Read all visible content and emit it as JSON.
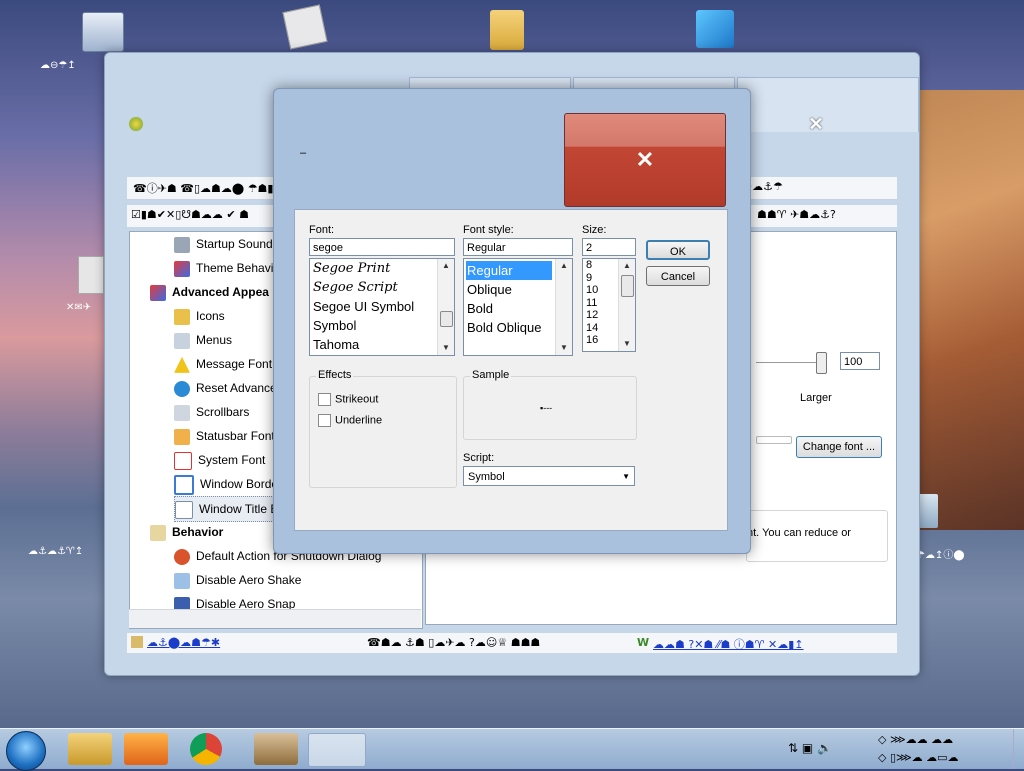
{
  "desktop": {
    "icon_labels": [
      "☁⊖☂↥",
      "✕✉✈",
      "☁⚓☁⚓♈↥",
      "☂☁↥ⓘ⬤"
    ]
  },
  "main_window": {
    "toolbar_glyphs": "☎ⓘ✈☗  ☎▯☁☗☁⬤ ☂☗▮",
    "toolbar2_glyphs": "☑▮☗✔✕▯☋☗☁☁ ✔ ☗",
    "toolbar_right_glyphs": "☗✈☁⚓☂",
    "toolbar2_right_glyphs": "☗☗♈ ✈☗☁⚓?",
    "tree_items": [
      {
        "label": "Startup Sound",
        "group": false
      },
      {
        "label": "Theme Behavio",
        "group": false
      },
      {
        "label": "Advanced Appea",
        "group": true
      },
      {
        "label": "Icons",
        "group": false
      },
      {
        "label": "Menus",
        "group": false
      },
      {
        "label": "Message Font",
        "group": false
      },
      {
        "label": "Reset Advance",
        "group": false
      },
      {
        "label": "Scrollbars",
        "group": false
      },
      {
        "label": "Statusbar Font",
        "group": false
      },
      {
        "label": "System Font",
        "group": false
      },
      {
        "label": "Window Borders",
        "group": false
      },
      {
        "label": "Window Title Ba",
        "group": false
      },
      {
        "label": "Behavior",
        "group": true
      },
      {
        "label": "Default Action for Shutdown Dialog",
        "group": false
      },
      {
        "label": "Disable Aero Shake",
        "group": false
      },
      {
        "label": "Disable Aero Snap",
        "group": false
      }
    ],
    "size_value": "100",
    "larger_label": "Larger",
    "change_font_label": "Change font ...",
    "description_text": "nt. You can reduce or",
    "status_glyphs_left": "☁⚓⬤☁☗☂✱",
    "status_glyphs_mid": "☎☗☁ ⚓☗ ▯☁✈☁ ?☁☺♕ ☗☗☗ ",
    "status_glyphs_right": "☁☁☗ ?✕☗ ⁄⁄☗ ⓘ☗♈ ✕☁▮↥",
    "status_w": "W"
  },
  "font_dialog": {
    "title": "–",
    "font_label": "Font:",
    "font_value": "segoe",
    "font_list": [
      "Segoe Print",
      "Segoe Script",
      "Segoe UI Symbol",
      "Symbol",
      "Tahoma"
    ],
    "style_label": "Font style:",
    "style_value": "Regular",
    "style_list": [
      "Regular",
      "Oblique",
      "Bold",
      "Bold Oblique"
    ],
    "size_label": "Size:",
    "size_value": "2",
    "size_list": [
      "8",
      "9",
      "10",
      "11",
      "12",
      "14",
      "16"
    ],
    "ok_label": "OK",
    "cancel_label": "Cancel",
    "effects_label": "Effects",
    "strikeout_label": "Strikeout",
    "underline_label": "Underline",
    "sample_label": "Sample",
    "sample_text": "▪---",
    "script_label": "Script:",
    "script_value": "Symbol"
  },
  "tray": {
    "glyphs_top": "◇ ⋙☁☁ ☁☁",
    "glyphs_bottom": "◇ ▯⋙☁ ☁▭☁"
  }
}
